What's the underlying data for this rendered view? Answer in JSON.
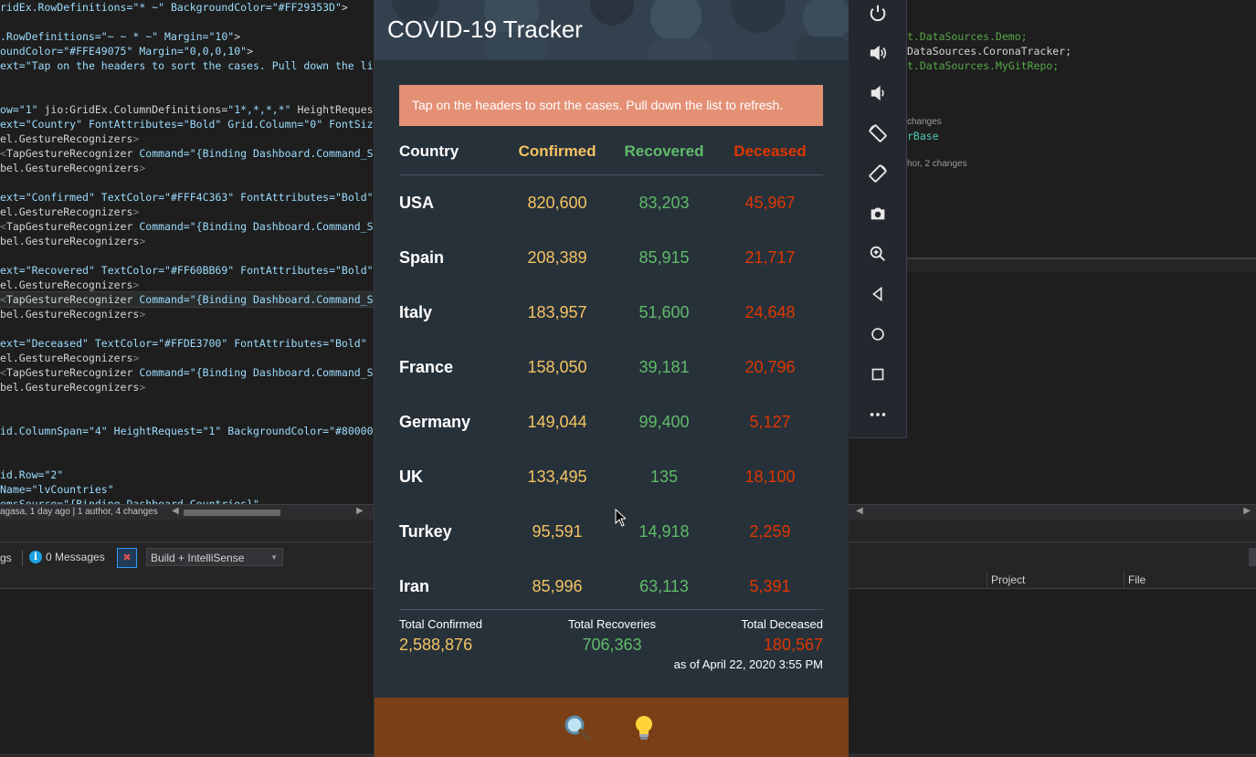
{
  "editor_left": {
    "lines": [
      [
        {
          "t": "ridEx.RowDefinitions=",
          "c": "attr"
        },
        {
          "t": "\"* ~\"",
          "c": "attr"
        },
        {
          "t": " BackgroundColor=",
          "c": "attr"
        },
        {
          "t": "\"#FF29353D\"",
          "c": "attr"
        },
        {
          "t": ">",
          "c": "plain"
        }
      ],
      [],
      [
        {
          "t": ".RowDefinitions=",
          "c": "attr"
        },
        {
          "t": "\"~ ~ * ~\"",
          "c": "attr"
        },
        {
          "t": " Margin=",
          "c": "attr"
        },
        {
          "t": "\"10\"",
          "c": "attr"
        },
        {
          "t": ">",
          "c": "plain"
        }
      ],
      [
        {
          "t": "oundColor=",
          "c": "attr"
        },
        {
          "t": "\"#FFE49075\"",
          "c": "attr"
        },
        {
          "t": " Margin=",
          "c": "attr"
        },
        {
          "t": "\"0,0,0,10\"",
          "c": "attr"
        },
        {
          "t": ">",
          "c": "plain"
        }
      ],
      [
        {
          "t": "ext=",
          "c": "attr"
        },
        {
          "t": "\"Tap on the headers to sort the cases. Pull down the li",
          "c": "attr"
        }
      ],
      [],
      [],
      [
        {
          "t": "ow=",
          "c": "attr"
        },
        {
          "t": "\"1\"",
          "c": "attr"
        },
        {
          "t": " jio:GridEx.ColumnDefinitions=",
          "c": "plain"
        },
        {
          "t": "\"1*,*,*,*\"",
          "c": "attr"
        },
        {
          "t": " HeightReques",
          "c": "plain"
        }
      ],
      [
        {
          "t": "ext=",
          "c": "attr"
        },
        {
          "t": "\"Country\"",
          "c": "attr"
        },
        {
          "t": " FontAttributes=",
          "c": "attr"
        },
        {
          "t": "\"Bold\"",
          "c": "attr"
        },
        {
          "t": " Grid.Column=",
          "c": "attr"
        },
        {
          "t": "\"0\"",
          "c": "attr"
        },
        {
          "t": " FontSiz",
          "c": "attr"
        }
      ],
      [
        {
          "t": "el.GestureRecognizers",
          "c": "plain"
        },
        {
          "t": ">",
          "c": "punc"
        }
      ],
      [
        {
          "t": "<",
          "c": "punc"
        },
        {
          "t": "TapGestureRecognizer",
          "c": "plain"
        },
        {
          "t": " Command=",
          "c": "attr"
        },
        {
          "t": "\"{Binding Dashboard.Command_S",
          "c": "attr"
        }
      ],
      [
        {
          "t": "bel.GestureRecognizers",
          "c": "plain"
        },
        {
          "t": ">",
          "c": "punc"
        }
      ],
      [],
      [
        {
          "t": "ext=",
          "c": "attr"
        },
        {
          "t": "\"Confirmed\"",
          "c": "attr"
        },
        {
          "t": " TextColor=",
          "c": "attr"
        },
        {
          "t": "\"#FFF4C363\"",
          "c": "attr"
        },
        {
          "t": " FontAttributes=",
          "c": "attr"
        },
        {
          "t": "\"Bold\"",
          "c": "attr"
        }
      ],
      [
        {
          "t": "el.GestureRecognizers",
          "c": "plain"
        },
        {
          "t": ">",
          "c": "punc"
        }
      ],
      [
        {
          "t": "<",
          "c": "punc"
        },
        {
          "t": "TapGestureRecognizer",
          "c": "plain"
        },
        {
          "t": " Command=",
          "c": "attr"
        },
        {
          "t": "\"{Binding Dashboard.Command_S",
          "c": "attr"
        }
      ],
      [
        {
          "t": "bel.GestureRecognizers",
          "c": "plain"
        },
        {
          "t": ">",
          "c": "punc"
        }
      ],
      [],
      [
        {
          "t": "ext=",
          "c": "attr"
        },
        {
          "t": "\"Recovered\"",
          "c": "attr"
        },
        {
          "t": " TextColor=",
          "c": "attr"
        },
        {
          "t": "\"#FF60BB69\"",
          "c": "attr"
        },
        {
          "t": " FontAttributes=",
          "c": "attr"
        },
        {
          "t": "\"Bold\"",
          "c": "attr"
        }
      ],
      [
        {
          "t": "el.GestureRecognizers",
          "c": "plain"
        },
        {
          "t": ">",
          "c": "punc"
        }
      ],
      [
        {
          "t": "<",
          "c": "punc"
        },
        {
          "t": "TapGestureRecognizer",
          "c": "plain"
        },
        {
          "t": " Command=",
          "c": "attr"
        },
        {
          "t": "\"{Binding Dashboard.Command_S",
          "c": "attr"
        }
      ],
      [
        {
          "t": "bel.GestureRecognizers",
          "c": "plain"
        },
        {
          "t": ">",
          "c": "punc"
        }
      ],
      [],
      [
        {
          "t": "ext=",
          "c": "attr"
        },
        {
          "t": "\"Deceased\"",
          "c": "attr"
        },
        {
          "t": " TextColor=",
          "c": "attr"
        },
        {
          "t": "\"#FFDE3700\"",
          "c": "attr"
        },
        {
          "t": " FontAttributes=",
          "c": "attr"
        },
        {
          "t": "\"Bold\"",
          "c": "attr"
        }
      ],
      [
        {
          "t": "el.GestureRecognizers",
          "c": "plain"
        },
        {
          "t": ">",
          "c": "punc"
        }
      ],
      [
        {
          "t": "<",
          "c": "punc"
        },
        {
          "t": "TapGestureRecognizer",
          "c": "plain"
        },
        {
          "t": " Command=",
          "c": "attr"
        },
        {
          "t": "\"{Binding Dashboard.Command_S",
          "c": "attr"
        }
      ],
      [
        {
          "t": "bel.GestureRecognizers",
          "c": "plain"
        },
        {
          "t": ">",
          "c": "punc"
        }
      ],
      [],
      [],
      [
        {
          "t": "id.ColumnSpan=",
          "c": "attr"
        },
        {
          "t": "\"4\"",
          "c": "attr"
        },
        {
          "t": " HeightRequest=",
          "c": "attr"
        },
        {
          "t": "\"1\"",
          "c": "attr"
        },
        {
          "t": " BackgroundColor=",
          "c": "attr"
        },
        {
          "t": "\"#80000",
          "c": "attr"
        }
      ],
      [],
      [],
      [
        {
          "t": "id.Row=",
          "c": "attr"
        },
        {
          "t": "\"2\"",
          "c": "attr"
        }
      ],
      [
        {
          "t": "Name=",
          "c": "attr"
        },
        {
          "t": "\"lvCountries\"",
          "c": "attr"
        }
      ],
      [
        {
          "t": "emsSource=",
          "c": "attr"
        },
        {
          "t": "\"{Binding Dashboard.Countries}\"",
          "c": "attr"
        }
      ]
    ],
    "highlight_line": 20,
    "blame": "agasa, 1 day ago | 1 author, 4 changes"
  },
  "editor_right": {
    "lines": [
      {
        "t": "t.DataSources.Demo;",
        "c": "#57a64a"
      },
      {
        "t": "DataSources.CoronaTracker;",
        "c": "#d4d4d4"
      },
      {
        "t": "t.DataSources.MyGitRepo;",
        "c": "#57a64a"
      }
    ],
    "lens1": "changes",
    "base": "rBase",
    "lens2": "hor, 2 changes"
  },
  "error_panel": {
    "ngs": "gs",
    "messages": "0 Messages",
    "scope": "Build + IntelliSense",
    "col_project": "Project",
    "col_file": "File"
  },
  "emulator": {
    "buttons": [
      "power-icon",
      "volume-up-icon",
      "volume-down-icon",
      "rotate-left-icon",
      "rotate-right-icon",
      "camera-icon",
      "zoom-icon",
      "back-icon",
      "home-icon",
      "overview-icon",
      "more-icon"
    ]
  },
  "app": {
    "title": "COVID-19 Tracker",
    "hint": "Tap on the headers to sort the cases. Pull down the list to refresh.",
    "headers": {
      "country": "Country",
      "confirmed": "Confirmed",
      "recovered": "Recovered",
      "deceased": "Deceased"
    },
    "rows": [
      {
        "country": "USA",
        "confirmed": "820,600",
        "recovered": "83,203",
        "deceased": "45,967"
      },
      {
        "country": "Spain",
        "confirmed": "208,389",
        "recovered": "85,915",
        "deceased": "21,717"
      },
      {
        "country": "Italy",
        "confirmed": "183,957",
        "recovered": "51,600",
        "deceased": "24,648"
      },
      {
        "country": "France",
        "confirmed": "158,050",
        "recovered": "39,181",
        "deceased": "20,796"
      },
      {
        "country": "Germany",
        "confirmed": "149,044",
        "recovered": "99,400",
        "deceased": "5,127"
      },
      {
        "country": "UK",
        "confirmed": "133,495",
        "recovered": "135",
        "deceased": "18,100"
      },
      {
        "country": "Turkey",
        "confirmed": "95,591",
        "recovered": "14,918",
        "deceased": "2,259"
      },
      {
        "country": "Iran",
        "confirmed": "85,996",
        "recovered": "63,113",
        "deceased": "5,391"
      }
    ],
    "totals": {
      "confirmed_label": "Total Confirmed",
      "confirmed": "2,588,876",
      "recoveries_label": "Total Recoveries",
      "recoveries": "706,363",
      "deceased_label": "Total Deceased",
      "deceased": "180,567"
    },
    "as_of": "as of April 22, 2020 3:55 PM",
    "colors": {
      "confirmed": "#F4C363",
      "recovered": "#60BB69",
      "deceased": "#DE3700",
      "banner": "#E49075",
      "footer": "#7A3F16"
    },
    "footer_icons": [
      "search-icon",
      "lightbulb-icon"
    ]
  }
}
